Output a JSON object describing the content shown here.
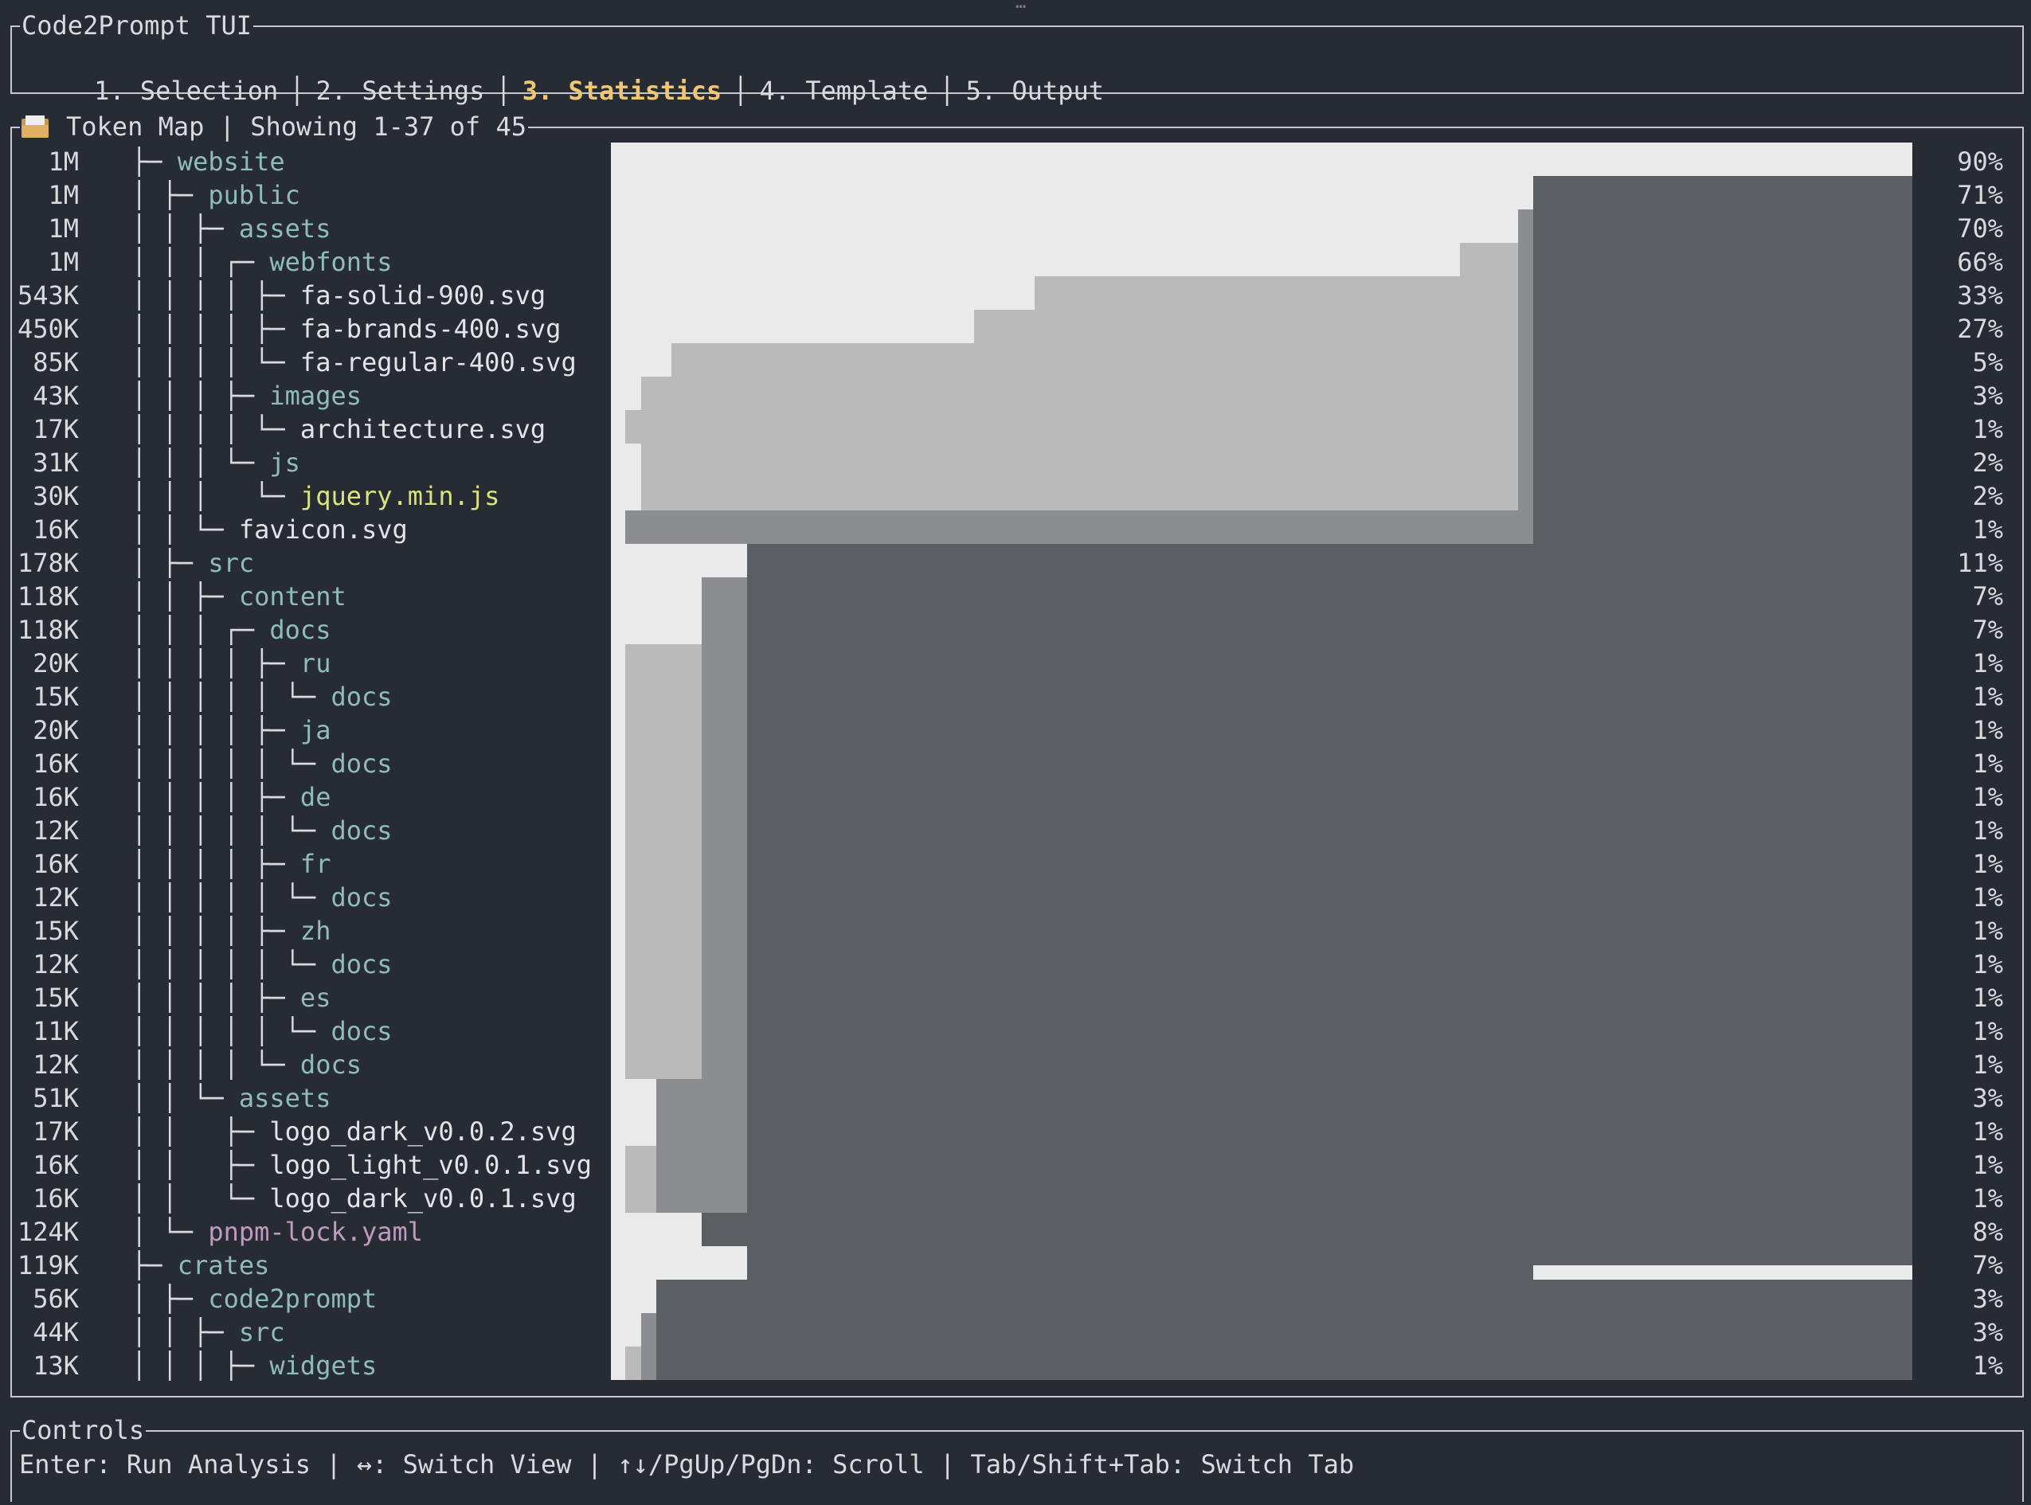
{
  "app": {
    "title": "Code2Prompt TUI"
  },
  "tabs": [
    {
      "label": "1. Selection",
      "active": false
    },
    {
      "label": "2. Settings",
      "active": false
    },
    {
      "label": "3. Statistics",
      "active": true
    },
    {
      "label": "4. Template",
      "active": false
    },
    {
      "label": "5. Output",
      "active": false
    }
  ],
  "token_map": {
    "title": "Token Map | Showing 1-37 of 45",
    "icon": "folder-icon",
    "rows": [
      {
        "size": "1M",
        "prefix": "├─",
        "name": "website",
        "kind": "dir",
        "pct": "90%"
      },
      {
        "size": "1M",
        "prefix": "│ ├─",
        "name": "public",
        "kind": "dir",
        "pct": "71%"
      },
      {
        "size": "1M",
        "prefix": "│ │ ├─",
        "name": "assets",
        "kind": "dir",
        "pct": "70%"
      },
      {
        "size": "1M",
        "prefix": "│ │ │ ┌─",
        "name": "webfonts",
        "kind": "dir",
        "pct": "66%"
      },
      {
        "size": "543K",
        "prefix": "│ │ │ │ ├─",
        "name": "fa-solid-900.svg",
        "kind": "file",
        "pct": "33%"
      },
      {
        "size": "450K",
        "prefix": "│ │ │ │ ├─",
        "name": "fa-brands-400.svg",
        "kind": "file",
        "pct": "27%"
      },
      {
        "size": "85K",
        "prefix": "│ │ │ │ └─",
        "name": "fa-regular-400.svg",
        "kind": "file",
        "pct": "5%"
      },
      {
        "size": "43K",
        "prefix": "│ │ │ ├─",
        "name": "images",
        "kind": "dir",
        "pct": "3%"
      },
      {
        "size": "17K",
        "prefix": "│ │ │ │ └─",
        "name": "architecture.svg",
        "kind": "file",
        "pct": "1%"
      },
      {
        "size": "31K",
        "prefix": "│ │ │ └─",
        "name": "js",
        "kind": "dir",
        "pct": "2%"
      },
      {
        "size": "30K",
        "prefix": "│ │ │   └─",
        "name": "jquery.min.js",
        "kind": "js",
        "pct": "2%"
      },
      {
        "size": "16K",
        "prefix": "│ │ └─",
        "name": "favicon.svg",
        "kind": "file",
        "pct": "1%"
      },
      {
        "size": "178K",
        "prefix": "│ ├─",
        "name": "src",
        "kind": "dir",
        "pct": "11%"
      },
      {
        "size": "118K",
        "prefix": "│ │ ├─",
        "name": "content",
        "kind": "dir",
        "pct": "7%"
      },
      {
        "size": "118K",
        "prefix": "│ │ │ ┌─",
        "name": "docs",
        "kind": "dir",
        "pct": "7%"
      },
      {
        "size": "20K",
        "prefix": "│ │ │ │ ├─",
        "name": "ru",
        "kind": "dir",
        "pct": "1%"
      },
      {
        "size": "15K",
        "prefix": "│ │ │ │ │ └─",
        "name": "docs",
        "kind": "dir",
        "pct": "1%"
      },
      {
        "size": "20K",
        "prefix": "│ │ │ │ ├─",
        "name": "ja",
        "kind": "dir",
        "pct": "1%"
      },
      {
        "size": "16K",
        "prefix": "│ │ │ │ │ └─",
        "name": "docs",
        "kind": "dir",
        "pct": "1%"
      },
      {
        "size": "16K",
        "prefix": "│ │ │ │ ├─",
        "name": "de",
        "kind": "dir",
        "pct": "1%"
      },
      {
        "size": "12K",
        "prefix": "│ │ │ │ │ └─",
        "name": "docs",
        "kind": "dir",
        "pct": "1%"
      },
      {
        "size": "16K",
        "prefix": "│ │ │ │ ├─",
        "name": "fr",
        "kind": "dir",
        "pct": "1%"
      },
      {
        "size": "12K",
        "prefix": "│ │ │ │ │ └─",
        "name": "docs",
        "kind": "dir",
        "pct": "1%"
      },
      {
        "size": "15K",
        "prefix": "│ │ │ │ ├─",
        "name": "zh",
        "kind": "dir",
        "pct": "1%"
      },
      {
        "size": "12K",
        "prefix": "│ │ │ │ │ └─",
        "name": "docs",
        "kind": "dir",
        "pct": "1%"
      },
      {
        "size": "15K",
        "prefix": "│ │ │ │ ├─",
        "name": "es",
        "kind": "dir",
        "pct": "1%"
      },
      {
        "size": "11K",
        "prefix": "│ │ │ │ │ └─",
        "name": "docs",
        "kind": "dir",
        "pct": "1%"
      },
      {
        "size": "12K",
        "prefix": "│ │ │ │ └─",
        "name": "docs",
        "kind": "dir",
        "pct": "1%"
      },
      {
        "size": "51K",
        "prefix": "│ │ └─",
        "name": "assets",
        "kind": "dir",
        "pct": "3%"
      },
      {
        "size": "17K",
        "prefix": "│ │   ├─",
        "name": "logo_dark_v0.0.2.svg",
        "kind": "file",
        "pct": "1%"
      },
      {
        "size": "16K",
        "prefix": "│ │   ├─",
        "name": "logo_light_v0.0.1.svg",
        "kind": "file",
        "pct": "1%"
      },
      {
        "size": "16K",
        "prefix": "│ │   └─",
        "name": "logo_dark_v0.0.1.svg",
        "kind": "file",
        "pct": "1%"
      },
      {
        "size": "124K",
        "prefix": "│ └─",
        "name": "pnpm-lock.yaml",
        "kind": "yaml",
        "pct": "8%"
      },
      {
        "size": "119K",
        "prefix": "├─",
        "name": "crates",
        "kind": "dir",
        "pct": "7%"
      },
      {
        "size": "56K",
        "prefix": "│ ├─",
        "name": "code2prompt",
        "kind": "dir",
        "pct": "3%"
      },
      {
        "size": "44K",
        "prefix": "│ │ ├─",
        "name": "src",
        "kind": "dir",
        "pct": "3%"
      },
      {
        "size": "13K",
        "prefix": "│ │ │ ├─",
        "name": "widgets",
        "kind": "dir",
        "pct": "1%"
      }
    ]
  },
  "controls": {
    "title": "Controls",
    "text": "Enter: Run Analysis | ↔: Switch View | ↑↓/PgUp/PgDn: Scroll | Tab/Shift+Tab: Switch Tab"
  },
  "colors": {
    "background": "#272b33",
    "active_tab": "#f0c674",
    "dir_name": "#8fbcbb",
    "js_name": "#d9e37f",
    "yaml_name": "#c09bbf"
  }
}
